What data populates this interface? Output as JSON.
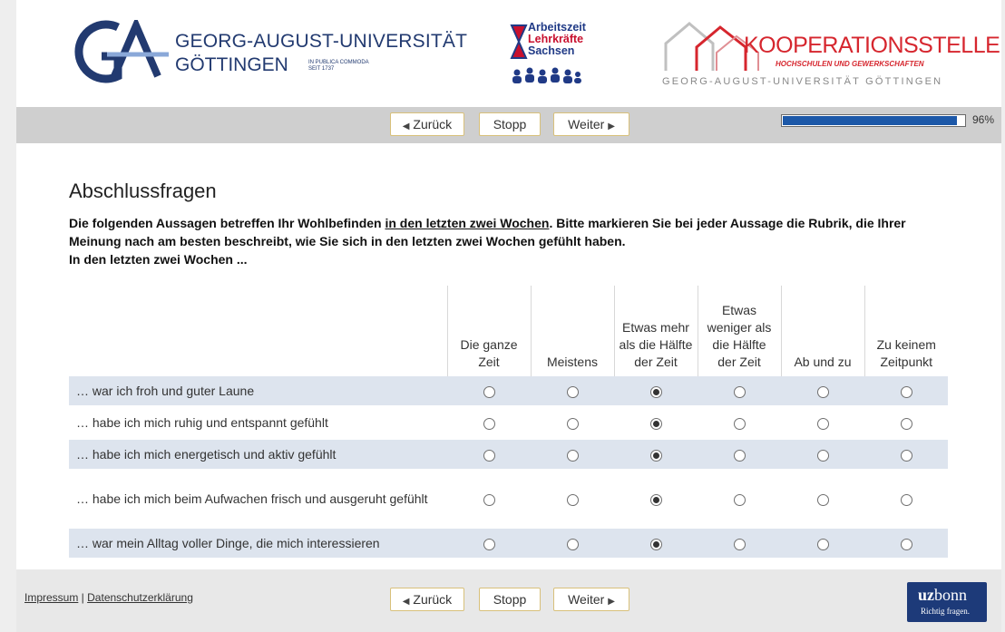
{
  "header": {
    "ga_logo": {
      "line1": "GEORG-AUGUST-UNIVERSITÄT",
      "line2": "GÖTTINGEN",
      "motto1": "IN PUBLICA COMMODA",
      "motto2": "SEIT 1737"
    },
    "als_logo": {
      "line1": "Arbeitszeit",
      "line2": "Lehrkräfte",
      "line3": "Sachsen"
    },
    "koop_logo": {
      "title": "KOOPERATIONSSTELLE",
      "subtitle": "HOCHSCHULEN UND GEWERKSCHAFTEN",
      "footer": "GEORG-AUGUST-UNIVERSITÄT GÖTTINGEN"
    }
  },
  "nav": {
    "back_label": "Zurück",
    "stop_label": "Stopp",
    "next_label": "Weiter",
    "progress_percent": 96,
    "progress_label": "96%"
  },
  "page": {
    "title": "Abschlussfragen",
    "intro_part1": "Die folgenden Aussagen betreffen Ihr Wohlbefinden ",
    "intro_underlined": "in den letzten zwei Wochen",
    "intro_part2": ". Bitte markieren Sie bei jeder Aussage die Rubrik, die Ihrer Meinung nach am besten beschreibt, wie Sie sich in den letzten zwei Wochen gefühlt haben.",
    "intro_line3": "In den letzten zwei Wochen ..."
  },
  "matrix": {
    "columns": [
      "Die ganze Zeit",
      "Meistens",
      "Etwas mehr als die Hälfte der Zeit",
      "Etwas weniger als die Hälfte der Zeit",
      "Ab und zu",
      "Zu keinem Zeitpunkt"
    ],
    "rows": [
      {
        "label": "… war ich froh und guter Laune",
        "selected": 2
      },
      {
        "label": "… habe ich mich ruhig und entspannt gefühlt",
        "selected": 2
      },
      {
        "label": "… habe ich mich energetisch und aktiv gefühlt",
        "selected": 2
      },
      {
        "label": "… habe ich mich beim Aufwachen frisch und ausgeruht gefühlt",
        "selected": 2
      },
      {
        "label": "… war mein Alltag voller Dinge, die mich interessieren",
        "selected": 2
      }
    ]
  },
  "footer": {
    "impressum": "Impressum",
    "separator": " | ",
    "datenschutz": "Datenschutzerklärung",
    "uz_logo": {
      "word_bold": "uz",
      "word_rest": "bonn",
      "slogan": "Richtig fragen."
    }
  }
}
